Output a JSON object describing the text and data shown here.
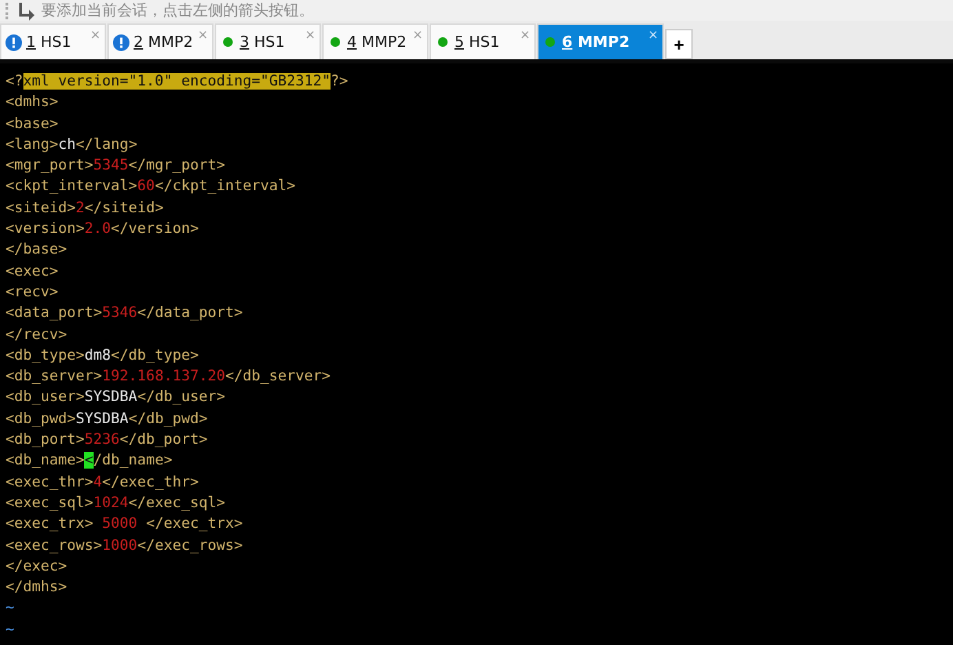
{
  "toolbar": {
    "hint": "要添加当前会话，点击左侧的箭头按钮。"
  },
  "tabs": [
    {
      "warning": true,
      "number": "1",
      "name": "HS1",
      "close": "×",
      "selected": false
    },
    {
      "warning": true,
      "number": "2",
      "name": "MMP2",
      "close": "×",
      "selected": false
    },
    {
      "warning": false,
      "number": "3",
      "name": "HS1",
      "close": "×",
      "selected": false
    },
    {
      "warning": false,
      "number": "4",
      "name": "MMP2",
      "close": "×",
      "selected": false
    },
    {
      "warning": false,
      "number": "5",
      "name": "HS1",
      "close": "×",
      "selected": false
    },
    {
      "warning": false,
      "number": "6",
      "name": "MMP2",
      "close": "×",
      "selected": true
    }
  ],
  "new_tab": "+",
  "editor": {
    "lines": [
      [
        {
          "kind": "tag",
          "text": "<?"
        },
        {
          "kind": "highlight",
          "text": "xml version=\"1.0\" encoding=\"GB2312\""
        },
        {
          "kind": "tag",
          "text": "?>"
        }
      ],
      [
        {
          "kind": "tag",
          "text": "<dmhs>"
        }
      ],
      [
        {
          "kind": "tag",
          "text": "<base>"
        }
      ],
      [
        {
          "kind": "tag",
          "text": "<lang>"
        },
        {
          "kind": "text",
          "text": "ch"
        },
        {
          "kind": "tag",
          "text": "</lang>"
        }
      ],
      [
        {
          "kind": "tag",
          "text": "<mgr_port>"
        },
        {
          "kind": "num",
          "text": "5345"
        },
        {
          "kind": "tag",
          "text": "</mgr_port>"
        }
      ],
      [
        {
          "kind": "tag",
          "text": "<ckpt_interval>"
        },
        {
          "kind": "num",
          "text": "60"
        },
        {
          "kind": "tag",
          "text": "</ckpt_interval>"
        }
      ],
      [
        {
          "kind": "tag",
          "text": "<siteid>"
        },
        {
          "kind": "num",
          "text": "2"
        },
        {
          "kind": "tag",
          "text": "</siteid>"
        }
      ],
      [
        {
          "kind": "tag",
          "text": "<version>"
        },
        {
          "kind": "num",
          "text": "2.0"
        },
        {
          "kind": "tag",
          "text": "</version>"
        }
      ],
      [
        {
          "kind": "tag",
          "text": "</base>"
        }
      ],
      [
        {
          "kind": "tag",
          "text": "<exec>"
        }
      ],
      [
        {
          "kind": "tag",
          "text": "<recv>"
        }
      ],
      [
        {
          "kind": "tag",
          "text": "<data_port>"
        },
        {
          "kind": "num",
          "text": "5346"
        },
        {
          "kind": "tag",
          "text": "</data_port>"
        }
      ],
      [
        {
          "kind": "tag",
          "text": "</recv>"
        }
      ],
      [
        {
          "kind": "tag",
          "text": "<db_type>"
        },
        {
          "kind": "text",
          "text": "dm8"
        },
        {
          "kind": "tag",
          "text": "</db_type>"
        }
      ],
      [
        {
          "kind": "tag",
          "text": "<db_server>"
        },
        {
          "kind": "num",
          "text": "192.168.137.20"
        },
        {
          "kind": "tag",
          "text": "</db_server>"
        }
      ],
      [
        {
          "kind": "tag",
          "text": "<db_user>"
        },
        {
          "kind": "text",
          "text": "SYSDBA"
        },
        {
          "kind": "tag",
          "text": "</db_user>"
        }
      ],
      [
        {
          "kind": "tag",
          "text": "<db_pwd>"
        },
        {
          "kind": "text",
          "text": "SYSDBA"
        },
        {
          "kind": "tag",
          "text": "</db_pwd>"
        }
      ],
      [
        {
          "kind": "tag",
          "text": "<db_port>"
        },
        {
          "kind": "num",
          "text": "5236"
        },
        {
          "kind": "tag",
          "text": "</db_port>"
        }
      ],
      [
        {
          "kind": "tag",
          "text": "<db_name>"
        },
        {
          "kind": "cursor",
          "text": "<"
        },
        {
          "kind": "tag",
          "text": "/db_name>"
        }
      ],
      [
        {
          "kind": "tag",
          "text": "<exec_thr>"
        },
        {
          "kind": "num",
          "text": "4"
        },
        {
          "kind": "tag",
          "text": "</exec_thr>"
        }
      ],
      [
        {
          "kind": "tag",
          "text": "<exec_sql>"
        },
        {
          "kind": "num",
          "text": "1024"
        },
        {
          "kind": "tag",
          "text": "</exec_sql>"
        }
      ],
      [
        {
          "kind": "tag",
          "text": "<exec_trx>"
        },
        {
          "kind": "num",
          "text": " 5000 "
        },
        {
          "kind": "tag",
          "text": "</exec_trx>"
        }
      ],
      [
        {
          "kind": "tag",
          "text": "<exec_rows>"
        },
        {
          "kind": "num",
          "text": "1000"
        },
        {
          "kind": "tag",
          "text": "</exec_rows>"
        }
      ],
      [
        {
          "kind": "tag",
          "text": "</exec>"
        }
      ],
      [
        {
          "kind": "tag",
          "text": "</dmhs>"
        }
      ],
      [
        {
          "kind": "tilde",
          "text": "~"
        }
      ],
      [
        {
          "kind": "tilde",
          "text": "~"
        }
      ]
    ]
  }
}
